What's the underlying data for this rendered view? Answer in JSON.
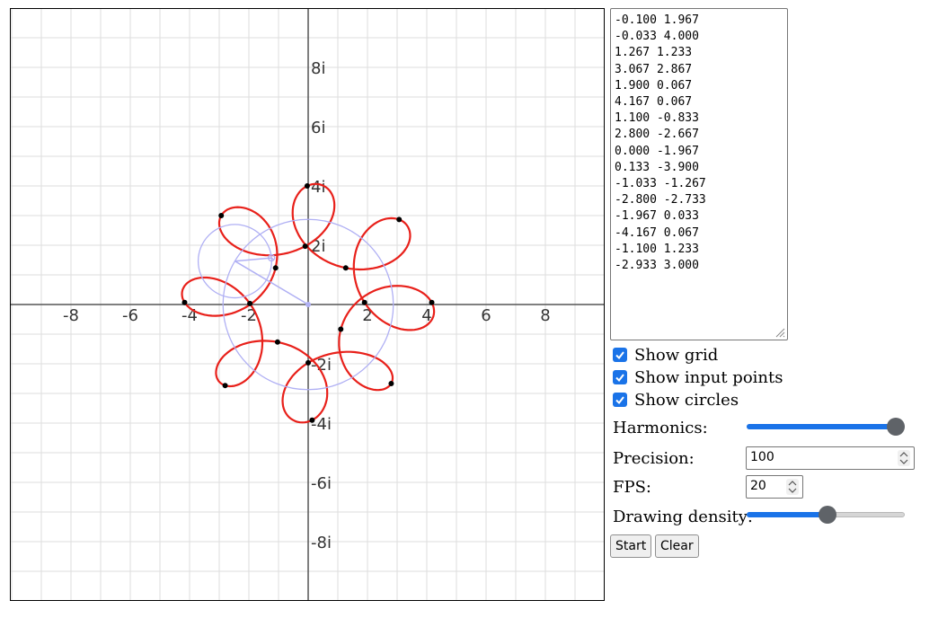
{
  "plot": {
    "x_ticks": [
      {
        "v": -8,
        "label": "-8"
      },
      {
        "v": -6,
        "label": "-6"
      },
      {
        "v": -4,
        "label": "-4"
      },
      {
        "v": -2,
        "label": "-2"
      },
      {
        "v": 2,
        "label": "2"
      },
      {
        "v": 4,
        "label": "4"
      },
      {
        "v": 6,
        "label": "6"
      },
      {
        "v": 8,
        "label": "8"
      }
    ],
    "y_ticks": [
      {
        "v": 8,
        "label": "8i"
      },
      {
        "v": 6,
        "label": "6i"
      },
      {
        "v": 4,
        "label": "4i"
      },
      {
        "v": 2,
        "label": "2i"
      },
      {
        "v": -2,
        "label": "-2i"
      },
      {
        "v": -4,
        "label": "-4i"
      },
      {
        "v": -6,
        "label": "-6i"
      },
      {
        "v": -8,
        "label": "-8i"
      }
    ],
    "points": [
      [
        -0.1,
        1.967
      ],
      [
        -0.033,
        4.0
      ],
      [
        1.267,
        1.233
      ],
      [
        3.067,
        2.867
      ],
      [
        1.9,
        0.067
      ],
      [
        4.167,
        0.067
      ],
      [
        1.1,
        -0.833
      ],
      [
        2.8,
        -2.667
      ],
      [
        0.0,
        -1.967
      ],
      [
        0.133,
        -3.9
      ],
      [
        -1.033,
        -1.267
      ],
      [
        -2.8,
        -2.733
      ],
      [
        -1.967,
        0.033
      ],
      [
        -4.167,
        0.067
      ],
      [
        -1.1,
        1.233
      ],
      [
        -2.933,
        3.0
      ]
    ],
    "colors": {
      "curve": "#e8201a",
      "grid": "#dddddd",
      "axis": "#555555",
      "circles": "#b0b0f4",
      "points": "#000000"
    }
  },
  "points_text": "-0.100 1.967\n-0.033 4.000\n1.267 1.233\n3.067 2.867\n1.900 0.067\n4.167 0.067\n1.100 -0.833\n2.800 -2.667\n0.000 -1.967\n0.133 -3.900\n-1.033 -1.267\n-2.800 -2.733\n-1.967 0.033\n-4.167 0.067\n-1.100 1.233\n-2.933 3.000",
  "controls": {
    "show_grid": {
      "label": "Show grid",
      "checked": true
    },
    "show_input_points": {
      "label": "Show input points",
      "checked": true
    },
    "show_circles": {
      "label": "Show circles",
      "checked": true
    },
    "harmonics_label": "Harmonics:",
    "harmonics_level": 1.0,
    "precision_label": "Precision:",
    "precision_value": "100",
    "fps_label": "FPS:",
    "fps_value": "20",
    "density_label": "Drawing density:",
    "density_level": 0.51,
    "start_label": "Start",
    "clear_label": "Clear",
    "accent_color": "#1a73e8",
    "thumb_color": "#5f6368"
  }
}
